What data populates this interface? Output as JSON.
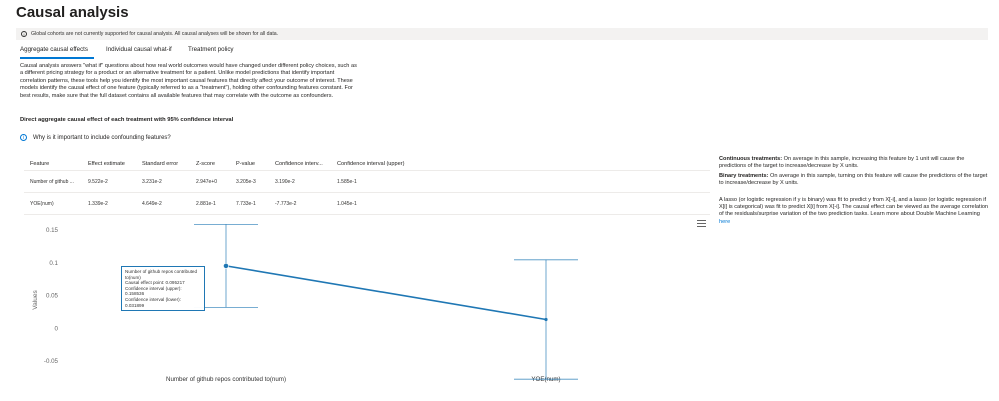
{
  "page": {
    "title": "Causal analysis"
  },
  "banner": {
    "text": "Global cohorts are not currently supported for causal analysis. All causal analyses will be shown for all data."
  },
  "tabs": [
    {
      "label": "Aggregate causal effects",
      "selected": true
    },
    {
      "label": "Individual causal what-if",
      "selected": false
    },
    {
      "label": "Treatment policy",
      "selected": false
    }
  ],
  "description": "Causal analysis answers \"what if\" questions about how real world outcomes would have changed under different policy choices, such as a different pricing strategy for a product or an alternative treatment for a patient. Unlike model predictions that identify important correlation patterns, these tools help you identify the most important causal features that directly affect your outcome of interest. These models identify the causal effect of one feature (typically referred to as a \"treatment\"), holding other confounding features constant. For best results, make sure that the full dataset contains all available features that may correlate with the outcome as confounders.",
  "section_title": "Direct aggregate causal effect of each treatment with 95% confidence interval",
  "why_link": "Why is it important to include confounding features?",
  "table": {
    "headers": [
      "Feature",
      "Effect estimate",
      "Standard error",
      "Z-score",
      "P-value",
      "Confidence interv...",
      "Confidence interval (upper)"
    ],
    "rows": [
      [
        "Number of github ...",
        "9.522e-2",
        "3.231e-2",
        "2.947e+0",
        "3.205e-3",
        "3.190e-2",
        "1.585e-1"
      ],
      [
        "YOE(num)",
        "1.339e-2",
        "4.649e-2",
        "2.881e-1",
        "7.733e-1",
        "-7.773e-2",
        "1.045e-1"
      ]
    ]
  },
  "info_panel": {
    "continuous_label": "Continuous treatments:",
    "continuous_text": "On average in this sample, increasing this feature by 1 unit will cause the predictions of the target to increase/decrease by X units.",
    "binary_label": "Binary treatments:",
    "binary_text": "On average in this sample, turning on this feature will cause the predictions of the target to increase/decrease by X units.",
    "lasso_text": "A lasso (or logistic regression if y is binary) was fit to predict y from X[-i], and a lasso (or logistic regression if X[i] is categorical) was fit to predict X[i] from X[-i]. The causal effect can be viewed as the average correlation of the residuals/surprise variation of the two prediction tasks. Learn more about Double Machine Learning",
    "link_text": "here"
  },
  "chart_data": {
    "type": "line",
    "categories": [
      "Number of github repos contributed to(num)",
      "YOE(num)"
    ],
    "series": [
      {
        "values": [
          0.095217,
          0.01339
        ],
        "error_lower": [
          0.031899,
          -0.07773
        ],
        "error_upper": [
          0.158536,
          0.1045
        ],
        "color": "#1f77b4"
      }
    ],
    "ylabel": "Values",
    "yticks": [
      0.15,
      0.1,
      0.05,
      0,
      -0.05
    ],
    "ytick_labels": [
      "0.15",
      "0.1",
      "0.05",
      "0",
      "-0.05"
    ],
    "ylim": [
      -0.07,
      0.17
    ],
    "grid": false
  },
  "tooltip": {
    "title": "Number of github repos contributed to(num)",
    "lines": [
      "Causal effect point: 0.095217",
      "Confidence interval (upper): 0.158536",
      "Confidence interval (lower): 0.031899"
    ]
  }
}
